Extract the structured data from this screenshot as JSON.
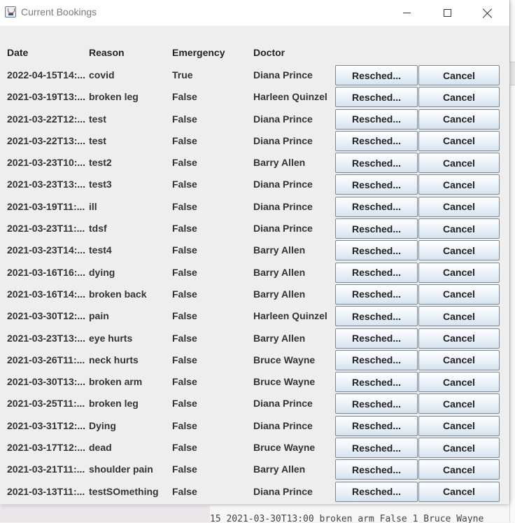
{
  "window": {
    "title": "Current Bookings"
  },
  "background": {
    "bottom_text": "15 2021-03-30T13:00 broken arm False 1 Bruce Wayne"
  },
  "table": {
    "headers": {
      "date": "Date",
      "reason": "Reason",
      "emergency": "Emergency",
      "doctor": "Doctor"
    },
    "reschedule_label": "Resched...",
    "cancel_label": "Cancel",
    "rows": [
      {
        "date": "2022-04-15T14:...",
        "reason": "covid",
        "emergency": "True",
        "doctor": "Diana Prince"
      },
      {
        "date": "2021-03-19T13:...",
        "reason": "broken leg",
        "emergency": "False",
        "doctor": "Harleen Quinzel"
      },
      {
        "date": "2021-03-22T12:...",
        "reason": "test",
        "emergency": "False",
        "doctor": "Diana Prince"
      },
      {
        "date": "2021-03-22T13:...",
        "reason": "test",
        "emergency": "False",
        "doctor": "Diana Prince"
      },
      {
        "date": "2021-03-23T10:...",
        "reason": "test2",
        "emergency": "False",
        "doctor": "Barry Allen"
      },
      {
        "date": "2021-03-23T13:...",
        "reason": "test3",
        "emergency": "False",
        "doctor": "Diana Prince"
      },
      {
        "date": "2021-03-19T11:...",
        "reason": "ill",
        "emergency": "False",
        "doctor": "Diana Prince"
      },
      {
        "date": "2021-03-23T11:...",
        "reason": "tdsf",
        "emergency": "False",
        "doctor": "Diana Prince"
      },
      {
        "date": "2021-03-23T14:...",
        "reason": "test4",
        "emergency": "False",
        "doctor": "Barry Allen"
      },
      {
        "date": "2021-03-16T16:...",
        "reason": "dying",
        "emergency": "False",
        "doctor": "Barry Allen"
      },
      {
        "date": "2021-03-16T14:...",
        "reason": "broken back",
        "emergency": "False",
        "doctor": "Barry Allen"
      },
      {
        "date": "2021-03-30T12:...",
        "reason": "pain",
        "emergency": "False",
        "doctor": "Harleen Quinzel"
      },
      {
        "date": "2021-03-23T13:...",
        "reason": "eye hurts",
        "emergency": "False",
        "doctor": "Barry Allen"
      },
      {
        "date": "2021-03-26T11:...",
        "reason": "neck hurts",
        "emergency": "False",
        "doctor": "Bruce Wayne"
      },
      {
        "date": "2021-03-30T13:...",
        "reason": "broken arm",
        "emergency": "False",
        "doctor": "Bruce Wayne"
      },
      {
        "date": "2021-03-25T11:...",
        "reason": "broken leg",
        "emergency": "False",
        "doctor": "Diana Prince"
      },
      {
        "date": "2021-03-31T12:...",
        "reason": "Dying",
        "emergency": "False",
        "doctor": "Diana Prince"
      },
      {
        "date": "2021-03-17T12:...",
        "reason": "dead",
        "emergency": "False",
        "doctor": "Bruce Wayne"
      },
      {
        "date": "2021-03-21T11:...",
        "reason": "shoulder pain",
        "emergency": "False",
        "doctor": "Barry Allen"
      },
      {
        "date": "2021-03-13T11:...",
        "reason": "testSOmething",
        "emergency": "False",
        "doctor": "Diana Prince"
      }
    ]
  }
}
